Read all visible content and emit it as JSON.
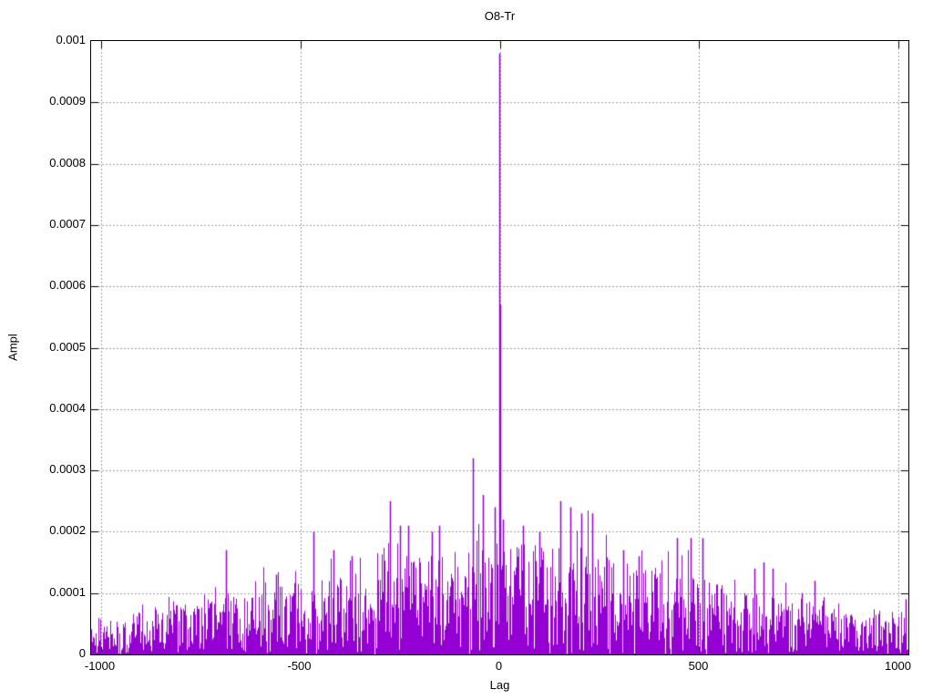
{
  "chart": {
    "title": "O8-Tr",
    "xlabel": "Lag",
    "ylabel": "Ampl"
  },
  "chart_data": {
    "type": "impulses",
    "title": "O8-Tr",
    "xlabel": "Lag",
    "ylabel": "Ampl",
    "xlim": [
      -1024,
      1024
    ],
    "ylim": [
      0,
      0.001
    ],
    "xticks": [
      -1000,
      -500,
      0,
      500,
      1000
    ],
    "x_tick_labels": [
      "-1000",
      "-500",
      "0",
      "500",
      "1000"
    ],
    "yticks": [
      0,
      0.0001,
      0.0002,
      0.0003,
      0.0004,
      0.0005,
      0.0006,
      0.0007,
      0.0008,
      0.0009,
      0.001
    ],
    "y_tick_labels": [
      "0",
      "0.0001",
      "0.0002",
      "0.0003",
      "0.0004",
      "0.0005",
      "0.0006",
      "0.0007",
      "0.0008",
      "0.0009",
      "0.001"
    ],
    "grid": {
      "visible": true,
      "style": "dotted",
      "color": "#9e9e9e",
      "dash": [
        2,
        2
      ]
    },
    "line_color": "#9400d3",
    "border_color": "#000000",
    "tick_length": 8,
    "peak": {
      "lag": 0,
      "value": 0.00098
    },
    "secondary_peak": {
      "lag": 3,
      "value": 0.00057
    },
    "n_points": 2048,
    "noise_seed": 1337,
    "noise_shape_exponent": 1.8,
    "tall_fraction": 0.04,
    "envelope": [
      [
        -1024,
        6e-05
      ],
      [
        -900,
        7e-05
      ],
      [
        -800,
        8e-05
      ],
      [
        -700,
        9e-05
      ],
      [
        -600,
        0.000105
      ],
      [
        -500,
        0.00012
      ],
      [
        -400,
        0.00013
      ],
      [
        -300,
        0.000145
      ],
      [
        -200,
        0.00016
      ],
      [
        -100,
        0.000175
      ],
      [
        0,
        0.00019
      ],
      [
        100,
        0.000175
      ],
      [
        200,
        0.00018
      ],
      [
        300,
        0.00015
      ],
      [
        400,
        0.00014
      ],
      [
        500,
        0.000125
      ],
      [
        600,
        0.000105
      ],
      [
        700,
        9e-05
      ],
      [
        800,
        8e-05
      ],
      [
        900,
        6.5e-05
      ],
      [
        980,
        5.5e-05
      ],
      [
        1024,
        8e-05
      ]
    ],
    "notable_peaks": [
      [
        -685,
        0.00017
      ],
      [
        -560,
        0.00013
      ],
      [
        -465,
        0.0002
      ],
      [
        -415,
        0.00017
      ],
      [
        -370,
        0.00016
      ],
      [
        -273,
        0.00025
      ],
      [
        -248,
        0.00021
      ],
      [
        -228,
        0.00021
      ],
      [
        -170,
        0.0002
      ],
      [
        -150,
        0.00021
      ],
      [
        -67,
        0.00032
      ],
      [
        -40,
        0.00026
      ],
      [
        -12,
        0.00024
      ],
      [
        0,
        0.00098
      ],
      [
        3,
        0.00057
      ],
      [
        8,
        0.00022
      ],
      [
        60,
        0.00021
      ],
      [
        100,
        0.0002
      ],
      [
        152,
        0.00025
      ],
      [
        178,
        0.00024
      ],
      [
        205,
        0.00023
      ],
      [
        232,
        0.00023
      ],
      [
        310,
        0.00017
      ],
      [
        350,
        0.00016
      ],
      [
        445,
        0.00019
      ],
      [
        480,
        0.00019
      ],
      [
        510,
        0.00019
      ],
      [
        640,
        0.00014
      ],
      [
        662,
        0.00015
      ],
      [
        685,
        0.00014
      ],
      [
        757,
        0.0001
      ],
      [
        790,
        0.00012
      ],
      [
        1018,
        9e-05
      ]
    ]
  }
}
